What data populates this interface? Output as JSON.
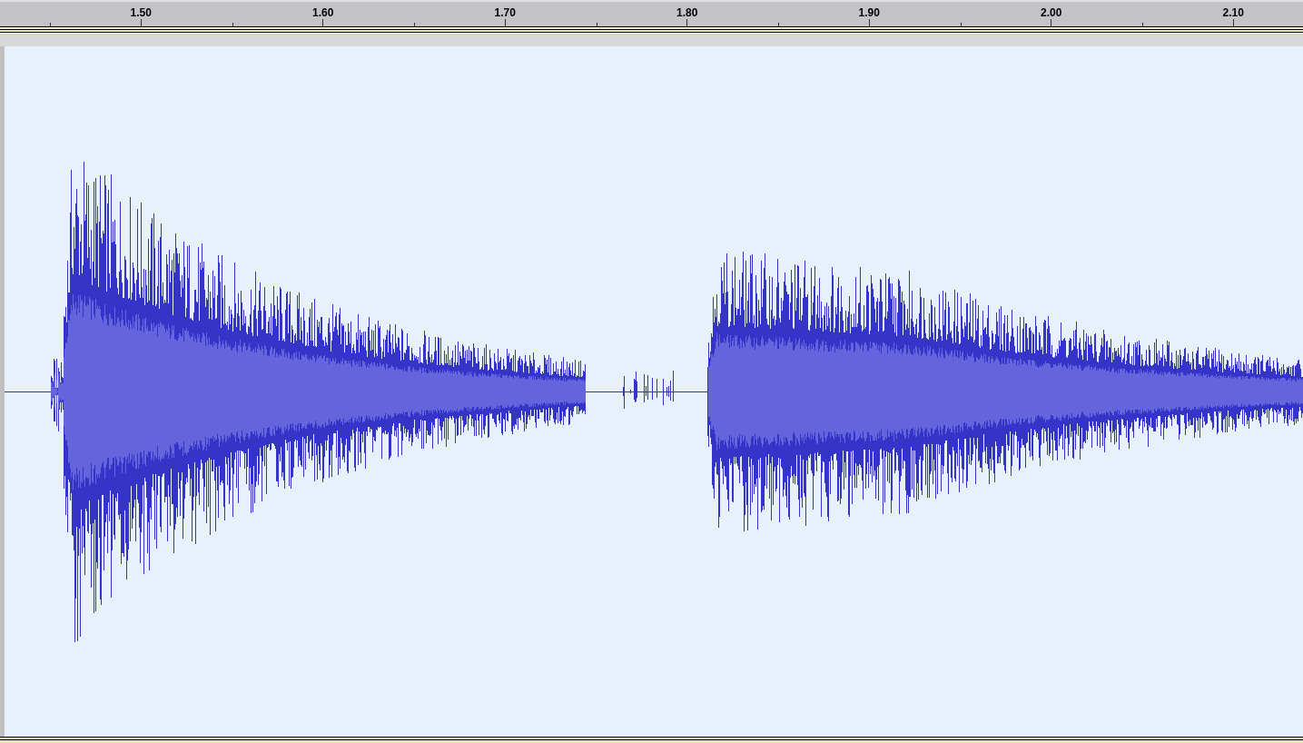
{
  "ruler": {
    "labels": [
      "1.50",
      "1.60",
      "1.70",
      "1.80",
      "1.90",
      "2.00",
      "2.10"
    ]
  }
}
